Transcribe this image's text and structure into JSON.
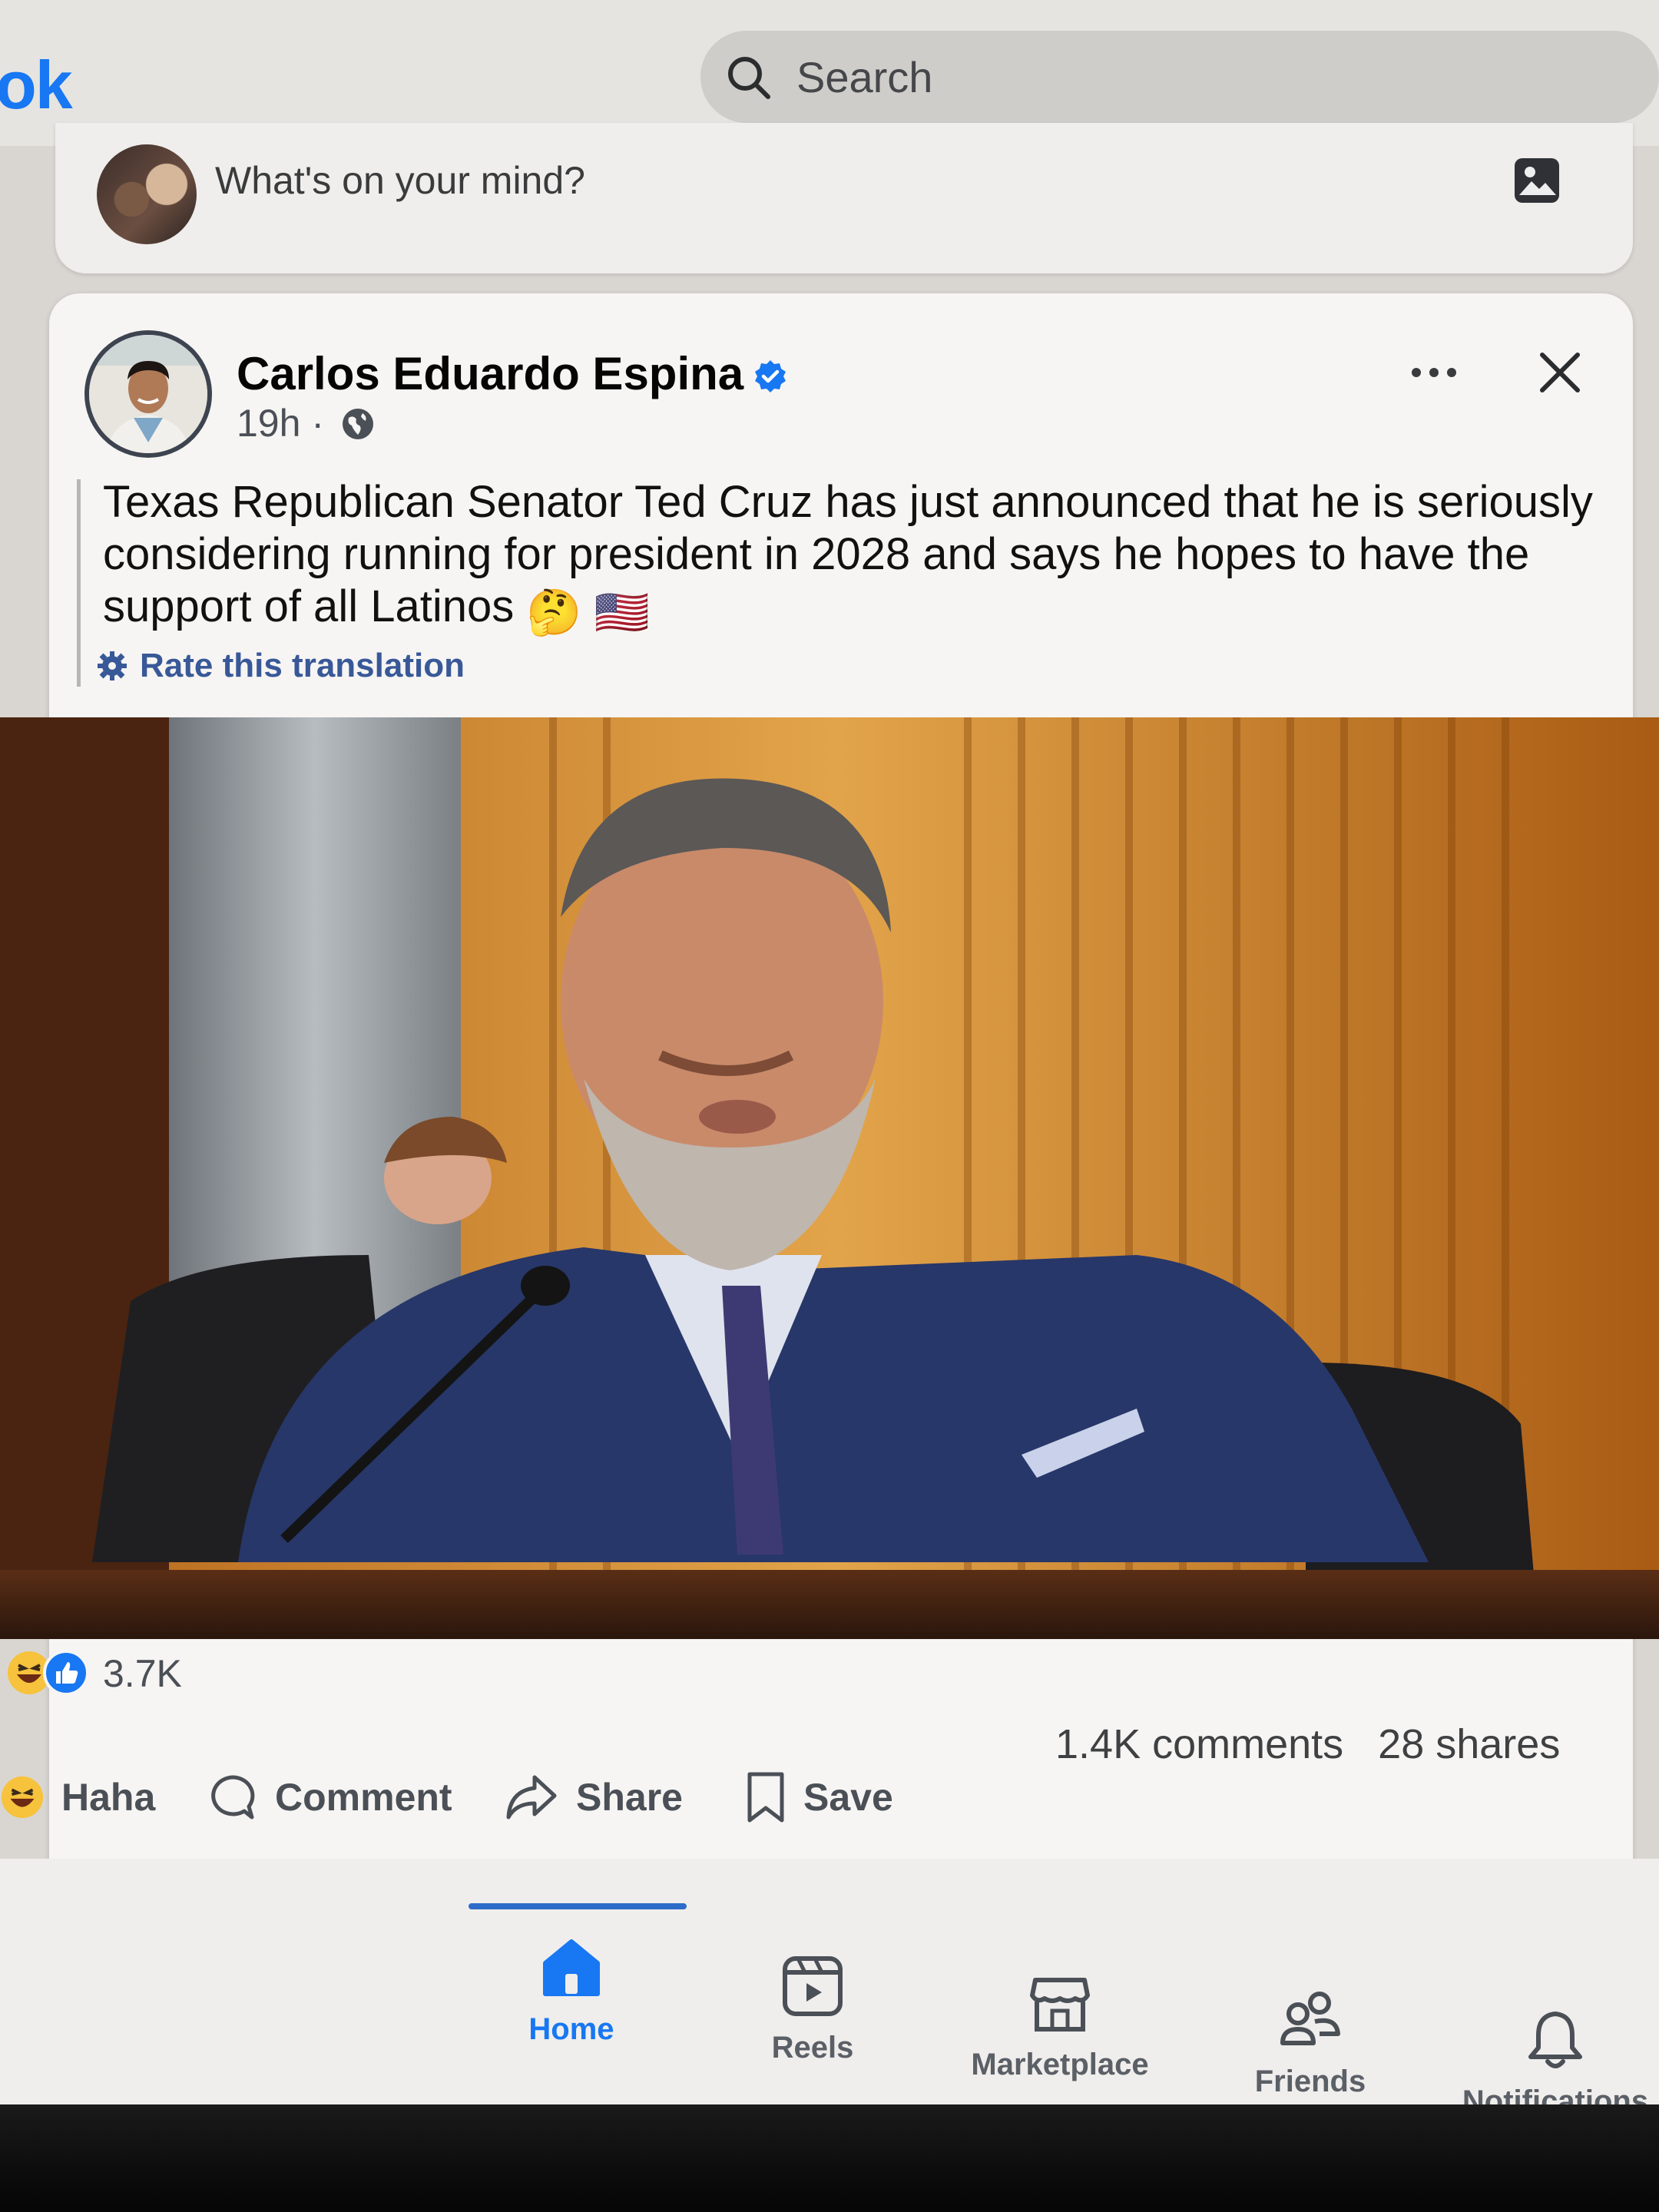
{
  "app": {
    "logo_text": "ok",
    "brand_color": "#1877f2"
  },
  "search": {
    "placeholder": "Search"
  },
  "composer": {
    "prompt": "What's on your mind?"
  },
  "post": {
    "author": "Carlos Eduardo Espina",
    "time": "19h",
    "separator": "·",
    "text": "Texas Republican Senator Ted Cruz has just announced that he is seriously considering running for president in 2028 and says he hopes to have the support of all Latinos",
    "emojis": [
      "🤔",
      "🇺🇸"
    ],
    "rate_translation": "Rate this translation",
    "reaction_count": "3.7K",
    "comments": "1.4K comments",
    "shares": "28 shares"
  },
  "actions": {
    "haha": "Haha",
    "comment": "Comment",
    "share": "Share",
    "save": "Save"
  },
  "nav": {
    "home": "Home",
    "reels": "Reels",
    "marketplace": "Marketplace",
    "friends": "Friends",
    "notifications": "Notifications"
  },
  "icons": [
    "search-icon",
    "photo-icon",
    "verified-icon",
    "globe-icon",
    "more-icon",
    "close-icon",
    "gear-icon",
    "haha-icon",
    "like-icon",
    "comment-icon",
    "share-icon",
    "save-icon",
    "home-icon",
    "reels-icon",
    "marketplace-icon",
    "friends-icon",
    "bell-icon"
  ]
}
